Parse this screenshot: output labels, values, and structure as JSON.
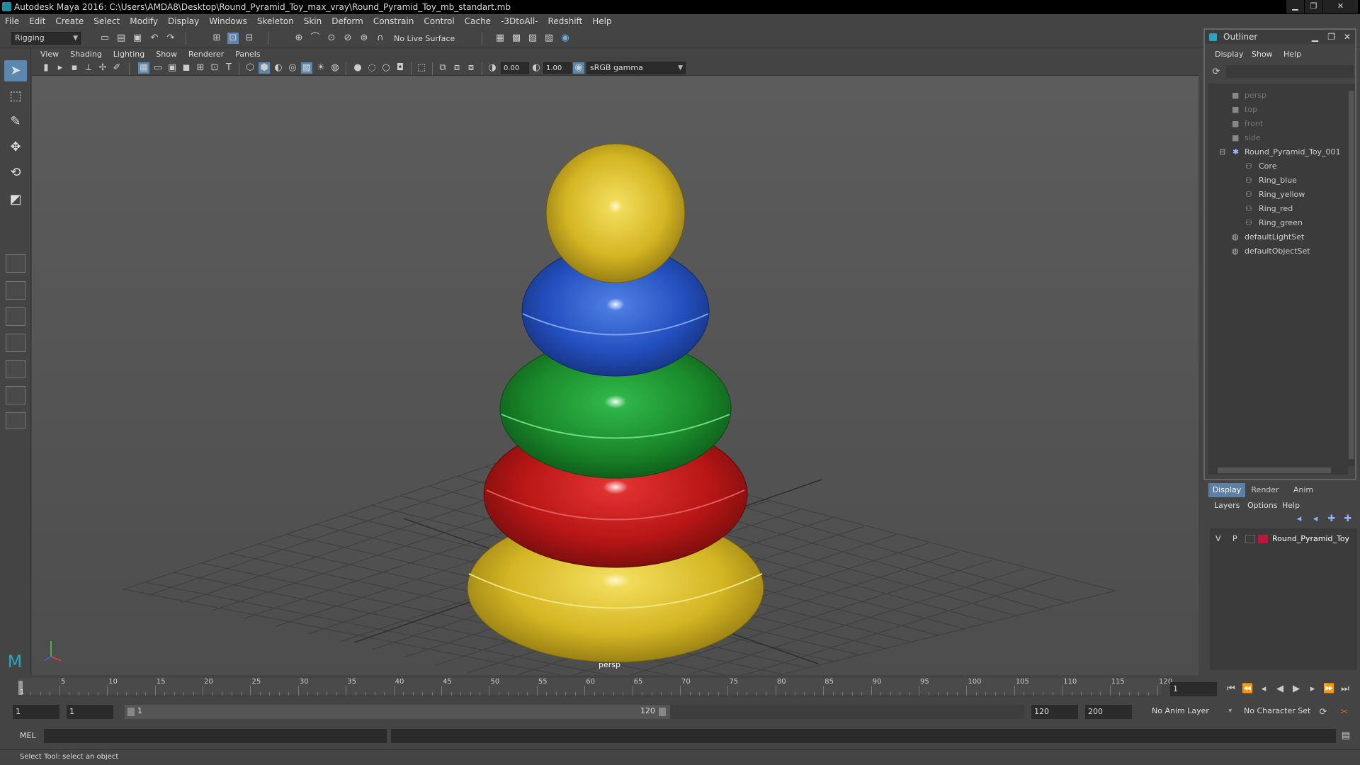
{
  "window": {
    "title": "Autodesk Maya 2016: C:\\Users\\AMDA8\\Desktop\\Round_Pyramid_Toy_max_vray\\Round_Pyramid_Toy_mb_standart.mb",
    "min": "▁",
    "max": "❐",
    "close": "✕"
  },
  "menu": [
    "File",
    "Edit",
    "Create",
    "Select",
    "Modify",
    "Display",
    "Windows",
    "Skeleton",
    "Skin",
    "Deform",
    "Constrain",
    "Control",
    "Cache",
    "-3DtoAll-",
    "Redshift",
    "Help"
  ],
  "status": {
    "menuset": "Rigging",
    "live_surface": "No Live Surface"
  },
  "panel": {
    "menu": [
      "View",
      "Shading",
      "Lighting",
      "Show",
      "Renderer",
      "Panels"
    ],
    "exposure": "0.00",
    "gamma": "1.00",
    "color_space": "sRGB gamma",
    "camera_label": "persp"
  },
  "outliner": {
    "title": "Outliner",
    "menu": [
      "Display",
      "Show",
      "Help"
    ],
    "items": [
      {
        "label": "persp",
        "dim": true
      },
      {
        "label": "top",
        "dim": true
      },
      {
        "label": "front",
        "dim": true
      },
      {
        "label": "side",
        "dim": true
      },
      {
        "label": "Round_Pyramid_Toy_001",
        "dim": false
      },
      {
        "label": "Core",
        "dim": false
      },
      {
        "label": "Ring_blue",
        "dim": false
      },
      {
        "label": "Ring_yellow",
        "dim": false
      },
      {
        "label": "Ring_red",
        "dim": false
      },
      {
        "label": "Ring_green",
        "dim": false
      },
      {
        "label": "defaultLightSet",
        "dim": false
      },
      {
        "label": "defaultObjectSet",
        "dim": false
      }
    ]
  },
  "channel": {
    "tabs": [
      "Display",
      "Render",
      "Anim"
    ],
    "menu": [
      "Layers",
      "Options",
      "Help"
    ],
    "layer": {
      "v": "V",
      "p": "P",
      "name": "Round_Pyramid_Toy",
      "color": "#c0143c"
    }
  },
  "timeline": {
    "ticks": [
      "5",
      "10",
      "15",
      "20",
      "25",
      "30",
      "35",
      "40",
      "45",
      "50",
      "55",
      "60",
      "65",
      "70",
      "75",
      "80",
      "85",
      "90",
      "95",
      "100",
      "105",
      "110",
      "115",
      "120"
    ],
    "start_tick": "1",
    "current_frame": "1"
  },
  "range": {
    "start": "1",
    "anim_start": "1",
    "slider_start": "1",
    "slider_end": "120",
    "end": "120",
    "anim_end": "200",
    "anim_layer": "No Anim Layer",
    "char_set": "No Character Set"
  },
  "cmd": {
    "label": "MEL"
  },
  "help": {
    "text": "Select Tool: select an object"
  },
  "colors": {
    "yellow": "#e0c528",
    "blue": "#2d5fcc",
    "green": "#1f9a30",
    "red": "#c41a1a"
  }
}
